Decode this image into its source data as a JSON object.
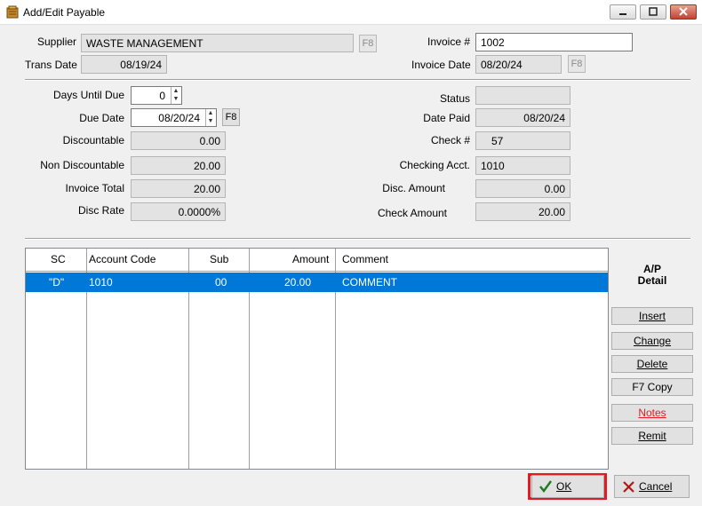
{
  "window": {
    "title": "Add/Edit Payable"
  },
  "header": {
    "supplier_label": "Supplier",
    "supplier_value": "WASTE MANAGEMENT",
    "supplier_lookup": "F8",
    "trans_date_label": "Trans Date",
    "trans_date_value": "08/19/24",
    "invoice_no_label": "Invoice #",
    "invoice_no_value": "1002",
    "invoice_date_label": "Invoice Date",
    "invoice_date_value": "08/20/24",
    "invoice_date_lookup": "F8"
  },
  "details": {
    "days_until_due_label": "Days Until Due",
    "days_until_due_value": "0",
    "due_date_label": "Due Date",
    "due_date_value": "08/20/24",
    "due_date_lookup": "F8",
    "discountable_label": "Discountable",
    "discountable_value": "0.00",
    "non_discountable_label": "Non Discountable",
    "non_discountable_value": "20.00",
    "invoice_total_label": "Invoice Total",
    "invoice_total_value": "20.00",
    "disc_rate_label": "Disc Rate",
    "disc_rate_value": "0.0000%",
    "status_label": "Status",
    "status_value": "",
    "date_paid_label": "Date Paid",
    "date_paid_value": "08/20/24",
    "check_no_label": "Check #",
    "check_no_value": "57",
    "checking_acct_label": "Checking Acct.",
    "checking_acct_value": "1010",
    "disc_amount_label": "Disc. Amount",
    "disc_amount_value": "0.00",
    "check_amount_label": "Check Amount",
    "check_amount_value": "20.00"
  },
  "grid": {
    "columns": [
      "SC",
      "Account Code",
      "Sub",
      "Amount",
      "Comment"
    ],
    "rows": [
      {
        "sc": "\"D\"",
        "account_code": "1010",
        "sub": "00",
        "amount": "20.00",
        "comment": "COMMENT"
      }
    ]
  },
  "sidebar": {
    "title_line1": "A/P",
    "title_line2": "Detail",
    "buttons": {
      "insert": "Insert",
      "change": "Change",
      "delete": "Delete",
      "copy": "F7 Copy",
      "notes": "Notes",
      "remit": "Remit"
    }
  },
  "footer": {
    "ok_label": "OK",
    "cancel_label": "Cancel"
  },
  "colors": {
    "selection": "#0078d7",
    "notes_text": "#e01b24",
    "highlight_outline": "#e01b24",
    "ok_check": "#1d7a1d",
    "cancel_x": "#b01818"
  }
}
